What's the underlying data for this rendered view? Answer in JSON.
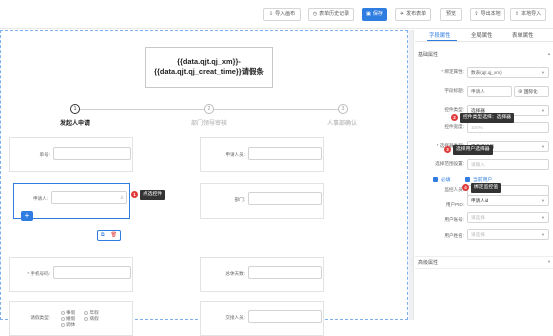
{
  "toolbar": {
    "import": "导入画布",
    "history": "表单历史记录",
    "save": "保存",
    "publish": "发布表单",
    "preview": "预览",
    "export_local": "导出本地",
    "import_local": "本地导入"
  },
  "form": {
    "title_line1": "{{data.qjt.qj_xm}}-",
    "title_line2": "{{data.qjt.qj_creat_time}}请假条",
    "steps": [
      {
        "num": "1",
        "label": "发起人申请"
      },
      {
        "num": "2",
        "label": "部门领导审核"
      },
      {
        "num": "3",
        "label": "人事部确认"
      }
    ],
    "fields": {
      "card_no": "单号:",
      "applicant_unit": "申请人员:",
      "applicant": "申请人:",
      "department": "部门:",
      "phone": "* 手机号码:",
      "leave_days": "总休天数:",
      "leave_type": "请假类型:",
      "handover": "交接人员:"
    },
    "leave_types": [
      "事假",
      "年假",
      "婚假",
      "病假",
      "调休"
    ],
    "add_icon": "+",
    "copy_icon": "⧉",
    "delete_icon": "🗑",
    "user_icon": "♙"
  },
  "tips": {
    "t1": {
      "num": "1",
      "text": "点选控件"
    },
    "t2": {
      "num": "2",
      "text": "控件类型选择：选择器"
    },
    "t3": {
      "num": "3",
      "text": "选择用户选择器"
    },
    "t4": {
      "num": "4",
      "text": "绑定监控值"
    }
  },
  "panel": {
    "tabs": [
      "字段属性",
      "全局属性",
      "表单属性"
    ],
    "section_basic": "基础属性",
    "bind_label": "* 绑定属性:",
    "bind_value": "数表(qjt.qj_xm)",
    "field_title_label": "字段标题:",
    "field_title_value": "申请人",
    "field_title_btn": "国际化",
    "control_type_label": "控件类型:",
    "control_type_value": "选择器",
    "width_label": "控件宽度:",
    "width_value": "100%",
    "selector_type_label": "* 选择器类型:",
    "selector_type_value": "用户选择器",
    "select_scope_label": "选择范围设置:",
    "select_scope_value": "请输入",
    "cb_required": "必填",
    "cb_current_user": "当前用户",
    "monitor_label": "监控人员:",
    "monitor_value": "请输入或绑定",
    "user_pid_label": "用户PID:",
    "user_pid_value": "申请人id",
    "user_account_label": "用户账号:",
    "user_account_value": "请选择",
    "user_name_label": "用户姓名:",
    "user_name_value": "请选择",
    "section_advanced": "高级属性"
  }
}
